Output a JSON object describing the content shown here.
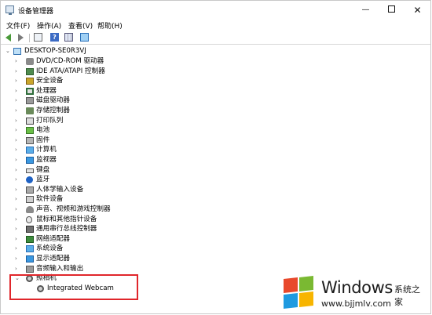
{
  "window": {
    "title": "设备管理器",
    "close_glyph": "✕",
    "minimize_glyph": "—"
  },
  "menu": [
    "文件(F)",
    "操作(A)",
    "查看(V)",
    "帮助(H)"
  ],
  "toolbar": {
    "icons": [
      "back-arrow-icon",
      "forward-arrow-icon",
      "properties-icon",
      "help-icon",
      "details-view-icon",
      "monitor-icon"
    ]
  },
  "tree": {
    "root": "DESKTOP-SE0R3VJ",
    "items": [
      {
        "label": "DVD/CD-ROM 驱动器",
        "icon": "disk-drive-icon",
        "expanded": false
      },
      {
        "label": "IDE ATA/ATAPI 控制器",
        "icon": "ide-controller-icon",
        "expanded": false
      },
      {
        "label": "安全设备",
        "icon": "security-device-icon",
        "expanded": false
      },
      {
        "label": "处理器",
        "icon": "processor-icon",
        "expanded": false
      },
      {
        "label": "磁盘驱动器",
        "icon": "hard-disk-icon",
        "expanded": false
      },
      {
        "label": "存储控制器",
        "icon": "storage-controller-icon",
        "expanded": false
      },
      {
        "label": "打印队列",
        "icon": "printer-icon",
        "expanded": false
      },
      {
        "label": "电池",
        "icon": "battery-icon",
        "expanded": false
      },
      {
        "label": "固件",
        "icon": "firmware-icon",
        "expanded": false
      },
      {
        "label": "计算机",
        "icon": "computer-icon",
        "expanded": false
      },
      {
        "label": "监视器",
        "icon": "monitor-icon",
        "expanded": false
      },
      {
        "label": "键盘",
        "icon": "keyboard-icon",
        "expanded": false
      },
      {
        "label": "蓝牙",
        "icon": "bluetooth-icon",
        "expanded": false
      },
      {
        "label": "人体学输入设备",
        "icon": "hid-icon",
        "expanded": false
      },
      {
        "label": "软件设备",
        "icon": "software-device-icon",
        "expanded": false
      },
      {
        "label": "声音、视频和游戏控制器",
        "icon": "sound-icon",
        "expanded": false
      },
      {
        "label": "鼠标和其他指针设备",
        "icon": "mouse-icon",
        "expanded": false
      },
      {
        "label": "通用串行总线控制器",
        "icon": "usb-icon",
        "expanded": false
      },
      {
        "label": "网络适配器",
        "icon": "network-adapter-icon",
        "expanded": false
      },
      {
        "label": "系统设备",
        "icon": "system-device-icon",
        "expanded": false
      },
      {
        "label": "显示适配器",
        "icon": "display-adapter-icon",
        "expanded": false
      },
      {
        "label": "音频输入和输出",
        "icon": "audio-io-icon",
        "expanded": false
      },
      {
        "label": "照相机",
        "icon": "camera-icon",
        "expanded": true
      }
    ],
    "child": {
      "label": "Integrated Webcam",
      "icon": "webcam-icon"
    }
  },
  "watermark": {
    "brand": "Windows",
    "brand_cn": "系统之家",
    "url": "www.bjjmlv.com"
  },
  "colors": {
    "highlight_border": "#e0262b",
    "logo_red": "#e8492c",
    "logo_green": "#7ab932",
    "logo_blue": "#1f9ae0",
    "logo_yellow": "#f7b500"
  }
}
